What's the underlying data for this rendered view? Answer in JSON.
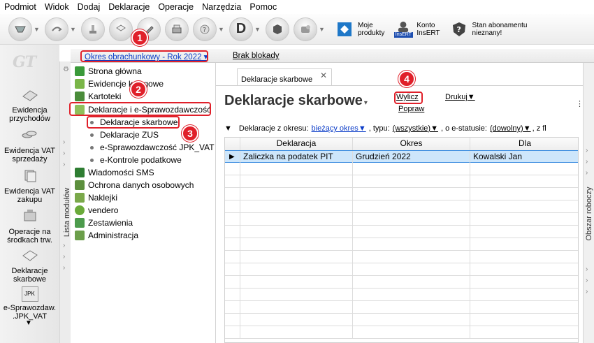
{
  "menu": [
    "Podmiot",
    "Widok",
    "Dodaj",
    "Deklaracje",
    "Operacje",
    "Narzędzia",
    "Pomoc"
  ],
  "toolbar": {
    "moje_produkty": "Moje\nprodukty",
    "konto_insert": "Konto\nInsERT",
    "stan_abonamentu": "Stan abonamentu\nnieznany!",
    "d_label": "D",
    "insert_badge": "InsERT"
  },
  "left_strip": {
    "logo": "GT",
    "items": [
      {
        "label": "Ewidencja\nprzychodów"
      },
      {
        "label": "Ewidencja VAT\nsprzedaży"
      },
      {
        "label": "Ewidencja VAT\nzakupu"
      },
      {
        "label": "Operacje na\nśrodkach trw."
      },
      {
        "label": "Deklaracje\nskarbowe"
      },
      {
        "label": "e-Sprawozdaw.\n.JPK_VAT"
      }
    ],
    "jpk_icon_text": "JPK"
  },
  "module_strip_label": "Lista modułów",
  "work_strip_label": "Obszar roboczy",
  "period": {
    "link": "Okres obrachunkowy - Rok 2022",
    "lock": "Brak blokady"
  },
  "tree": {
    "items": [
      {
        "label": "Strona główna",
        "color": "#3a9a3a"
      },
      {
        "label": "Ewidencje księgowe",
        "color": "#7ab648"
      },
      {
        "label": "Kartoteki",
        "color": "#4a8c3a"
      },
      {
        "label": "Deklaracje i e-Sprawozdawczość",
        "color": "#8fbf5a"
      },
      {
        "label": "Wiadomości SMS",
        "color": "#2e7d32"
      },
      {
        "label": "Ochrona danych osobowych",
        "color": "#5c8f3d"
      },
      {
        "label": "Naklejki",
        "color": "#7aa84a"
      },
      {
        "label": "vendero",
        "color": "#6aaa3a"
      },
      {
        "label": "Zestawienia",
        "color": "#4c9b4c"
      },
      {
        "label": "Administracja",
        "color": "#6b9e4a"
      }
    ],
    "subitems": [
      "Deklaracje skarbowe",
      "Deklaracje ZUS",
      "e-Sprawozdawczość JPK_VAT",
      "e-Kontrole podatkowe"
    ]
  },
  "main": {
    "tab_label": "Deklaracje skarbowe",
    "title": "Deklaracje skarbowe",
    "actions": {
      "wylicz": "Wylicz",
      "popraw": "Popraw",
      "drukuj": "Drukuj"
    },
    "filter": {
      "prefix": "Deklaracje z okresu:",
      "okres": "bieżący okres",
      "typu_label": ", typu:",
      "typu": "(wszystkie)",
      "status_label": ", o e-statusie:",
      "status": "(dowolny)",
      "suffix": ", z fl"
    },
    "columns": [
      "Deklaracja",
      "Okres",
      "Dla"
    ],
    "rows": [
      {
        "deklaracja": "Zaliczka na podatek PIT",
        "okres": "Grudzień 2022",
        "dla": "Kowalski Jan"
      }
    ]
  },
  "annotations": [
    "1",
    "2",
    "3",
    "4"
  ],
  "colors": {
    "accent_red": "#e0202a",
    "link_blue": "#0b3cc8",
    "selection": "#cde6fb"
  }
}
